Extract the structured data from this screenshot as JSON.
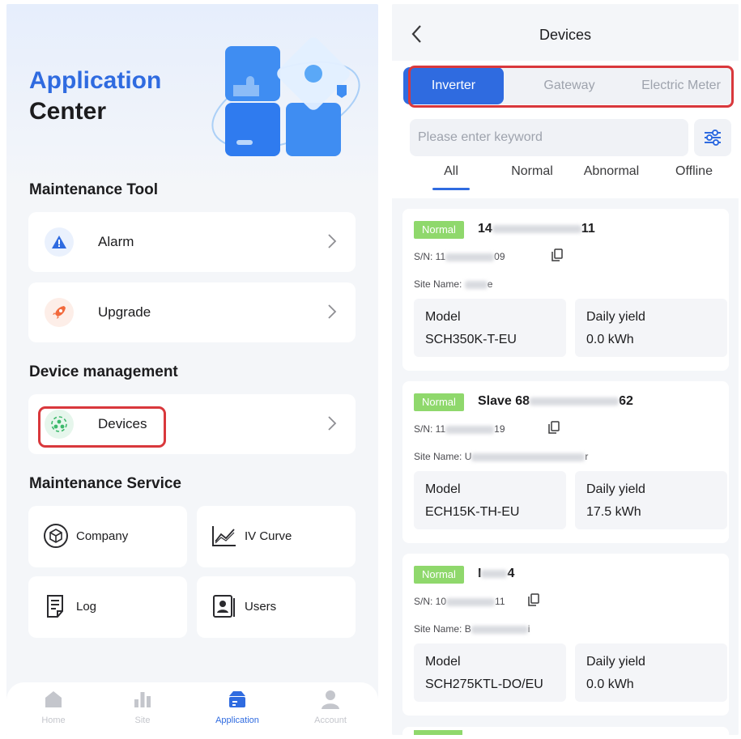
{
  "left": {
    "title_line1": "Application",
    "title_line2": "Center",
    "sections": {
      "maintenance_tool": "Maintenance Tool",
      "device_management": "Device management",
      "maintenance_service": "Maintenance Service"
    },
    "tools": {
      "alarm": "Alarm",
      "upgrade": "Upgrade",
      "devices": "Devices"
    },
    "services": {
      "company": "Company",
      "iv_curve": "IV Curve",
      "log": "Log",
      "users": "Users"
    },
    "tabbar": {
      "home": "Home",
      "site": "Site",
      "application": "Application",
      "account": "Account",
      "active": "Application"
    }
  },
  "right": {
    "nav_title": "Devices",
    "segments": [
      "Inverter",
      "Gateway",
      "Electric Meter"
    ],
    "active_segment": "Inverter",
    "search": {
      "placeholder": "Please enter keyword",
      "value": ""
    },
    "status_tabs": [
      "All",
      "Normal",
      "Abnormal",
      "Offline"
    ],
    "active_status_tab": "All",
    "devices": [
      {
        "status": "Normal",
        "name_prefix": "14",
        "name_suffix": "11",
        "sn_prefix": "S/N: 11",
        "sn_suffix": "09",
        "site_prefix": "Site Name:",
        "site_suffix": "e",
        "model_label": "Model",
        "model": "SCH350K-T-EU",
        "yield_label": "Daily yield",
        "yield": "0.0 kWh"
      },
      {
        "status": "Normal",
        "name_prefix": "Slave 68",
        "name_suffix": "62",
        "sn_prefix": "S/N: 11",
        "sn_suffix": "19",
        "site_prefix": "Site Name: U",
        "site_suffix": "r",
        "model_label": "Model",
        "model": "ECH15K-TH-EU",
        "yield_label": "Daily yield",
        "yield": "17.5 kWh"
      },
      {
        "status": "Normal",
        "name_prefix": "I",
        "name_suffix": "4",
        "sn_prefix": "S/N: 10",
        "sn_suffix": "11",
        "site_prefix": "Site Name: B",
        "site_suffix": "i",
        "model_label": "Model",
        "model": "SCH275KTL-DO/EU",
        "yield_label": "Daily yield",
        "yield": "0.0 kWh"
      }
    ]
  },
  "colors": {
    "accent": "#2f6be0",
    "highlight_border": "#d9383c",
    "status_normal": "#8fd86c",
    "alarm_icon": "#2f6be0",
    "upgrade_icon": "#f26a3d",
    "devices_icon": "#3cb86a"
  },
  "icons": {
    "alarm": "warning-triangle-icon",
    "upgrade": "rocket-icon",
    "devices": "devices-cluster-icon",
    "company": "cube-icon",
    "iv_curve": "line-chart-icon",
    "log": "document-icon",
    "users": "user-card-icon",
    "filter": "sliders-icon",
    "copy": "copy-icon",
    "back": "chevron-left-icon"
  }
}
